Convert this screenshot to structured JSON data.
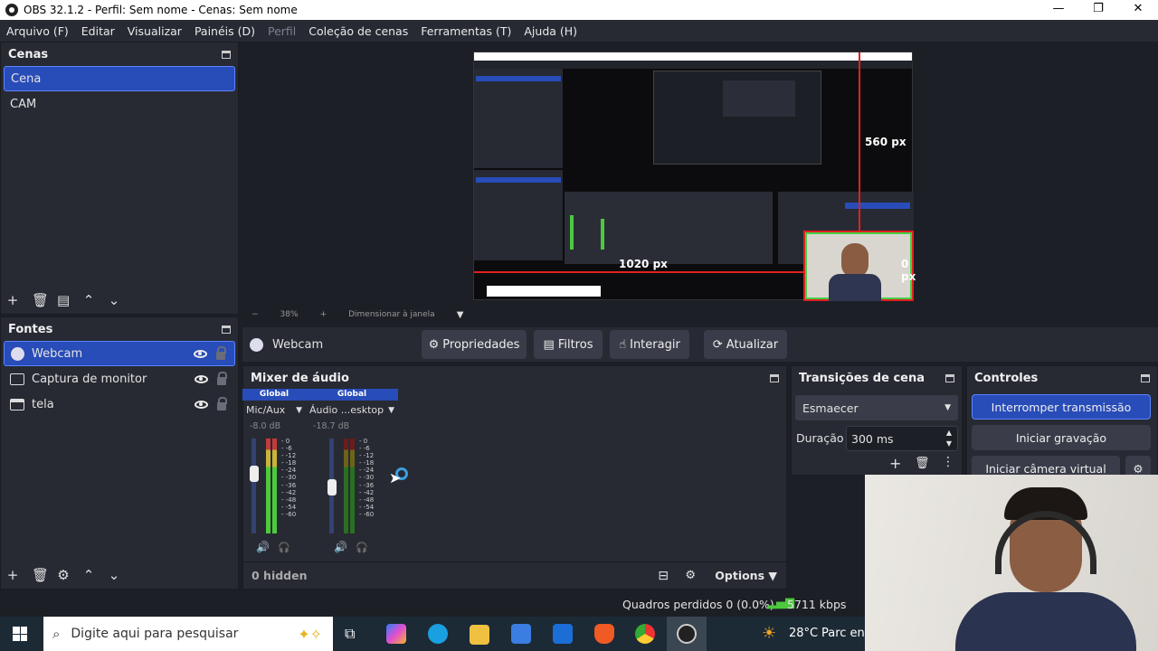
{
  "window": {
    "title": "OBS 32.1.2 - Perfil: Sem nome - Cenas: Sem nome",
    "minimize": "—",
    "maximize": "❐",
    "close": "✕"
  },
  "menu": [
    {
      "label": "Arquivo (F)"
    },
    {
      "label": "Editar"
    },
    {
      "label": "Visualizar"
    },
    {
      "label": "Painéis (D)"
    },
    {
      "label": "Perfil"
    },
    {
      "label": "Coleção de cenas"
    },
    {
      "label": "Ferramentas (T)"
    },
    {
      "label": "Ajuda (H)"
    }
  ],
  "scenes": {
    "title": "Cenas",
    "items": [
      {
        "label": "Cena",
        "selected": true
      },
      {
        "label": "CAM",
        "selected": false
      }
    ]
  },
  "sources": {
    "title": "Fontes",
    "items": [
      {
        "label": "Webcam",
        "icon": "webcam-icon",
        "selected": true
      },
      {
        "label": "Captura de monitor",
        "icon": "monitor-icon",
        "selected": false
      },
      {
        "label": "tela",
        "icon": "window-icon",
        "selected": false
      }
    ]
  },
  "preview": {
    "zoom": "38%",
    "fit_label": "Dimensionar à janela",
    "measure_top": "560 px",
    "measure_left": "1020 px",
    "measure_right": "0 px"
  },
  "context": {
    "source_name": "Webcam",
    "properties": "Propriedades",
    "filters": "Filtros",
    "interact": "Interagir",
    "refresh": "Atualizar"
  },
  "mixer": {
    "title": "Mixer de áudio",
    "channels": [
      {
        "badge": "Global",
        "name": "Mic/Aux",
        "db": "-8.0 dB",
        "volume": 0.65
      },
      {
        "badge": "Global",
        "name": "Áudio ...esktop",
        "db": "-18.7 dB",
        "volume": 0.48
      }
    ],
    "scale": [
      "0",
      "-6",
      "-12",
      "-18",
      "-24",
      "-30",
      "-36",
      "-42",
      "-48",
      "-54",
      "-60"
    ],
    "hidden": "0 hidden",
    "options": "Options"
  },
  "transitions": {
    "title": "Transições de cena",
    "selected": "Esmaecer",
    "duration_label": "Duração",
    "duration": "300 ms"
  },
  "controls": {
    "title": "Controles",
    "stop_stream": "Interromper transmissão",
    "start_record": "Iniciar gravação",
    "virtual_cam": "Iniciar câmera virtual"
  },
  "status": {
    "dropped": "Quadros perdidos 0 (0.0%)",
    "bitrate": "5711 kbps"
  },
  "taskbar": {
    "search_placeholder": "Digite aqui para pesquisar",
    "weather": "28°C",
    "weather_text": "Parc ens"
  },
  "colors": {
    "accent": "#284cb8",
    "panel": "#272a33",
    "bg": "#1d1f26",
    "meter_green": "#4cca3c",
    "meter_yellow": "#c8b53a",
    "meter_red": "#c23a3a"
  }
}
